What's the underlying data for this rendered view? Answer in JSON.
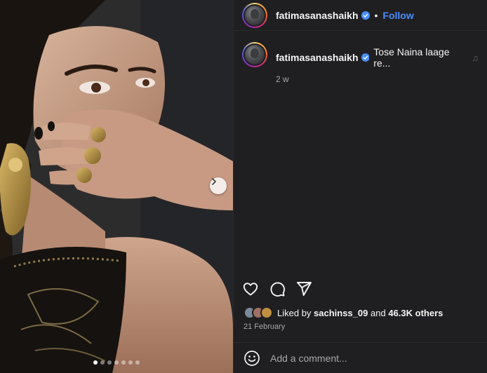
{
  "post": {
    "username": "fatimasanashaikh",
    "verified": true,
    "separator": "•",
    "follow_label": "Follow",
    "caption": "Tose Naina laage re...",
    "caption_icon": "music-note-icon",
    "time_ago": "2 w",
    "likes": {
      "prefix": "Liked by",
      "user": "sachinss_09",
      "middle": "and",
      "count": "46.3K others"
    },
    "date": "21 February",
    "comment_placeholder": "Add a comment..."
  },
  "carousel": {
    "total": 7,
    "active_index": 0
  },
  "colors": {
    "accent": "#4a8fff",
    "verified": "#4a8fff",
    "panel_bg": "#1f1f22"
  }
}
